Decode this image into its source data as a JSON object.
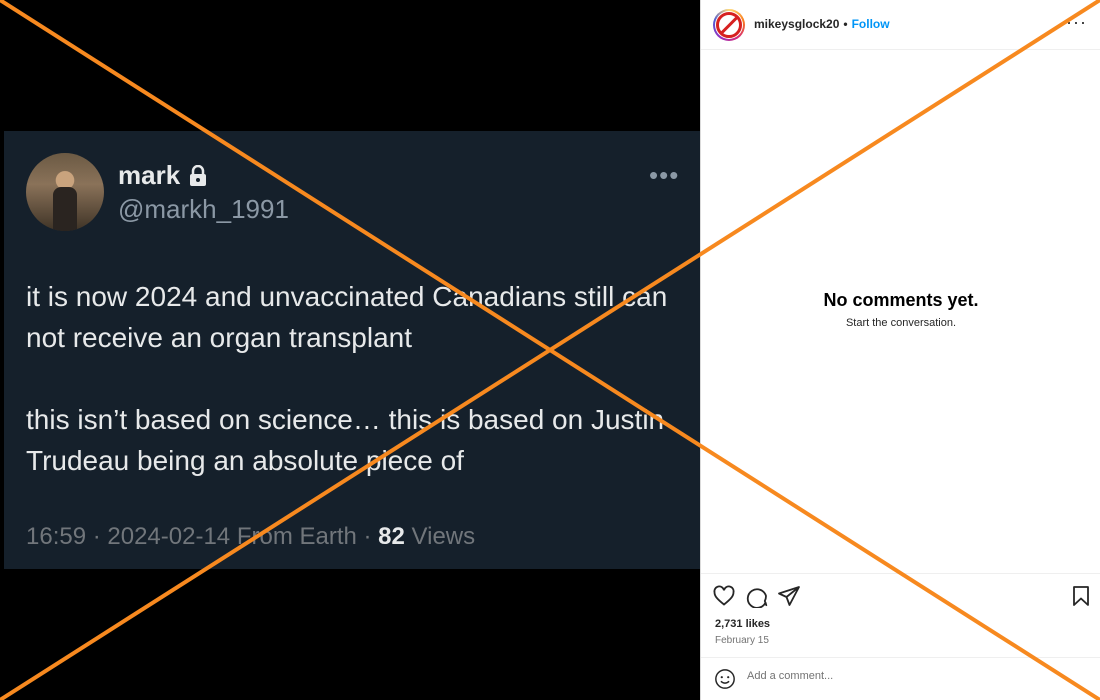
{
  "tweet": {
    "name": "mark",
    "lock_icon": "lock-icon",
    "handle": "@markh_1991",
    "more": "•••",
    "paragraphs": [
      "it is now 2024 and unvaccinated Canadians still can not receive an organ transplant",
      "this isn’t based on science… this is based on Justin Trudeau being an absolute piece of"
    ],
    "meta_prefix": "16:59 · 2024-02-14 From Earth · ",
    "views_count": "82",
    "views_label": " Views"
  },
  "instagram": {
    "username": "mikeysglock20",
    "separator": "•",
    "follow_label": "Follow",
    "more": "···",
    "empty_title": "No comments yet.",
    "empty_subtitle": "Start the conversation.",
    "likes": "2,731 likes",
    "date": "February 15",
    "comment_placeholder": "Add a comment...",
    "icons": [
      "heart-icon",
      "comment-icon",
      "share-icon",
      "bookmark-icon",
      "emoji-icon"
    ]
  },
  "overlay": {
    "color": "#f7891f",
    "mark": "x-cross"
  },
  "colors": {
    "tweet_bg": "#15202b",
    "follow": "#0095f6",
    "x_mark": "#f7891f"
  }
}
